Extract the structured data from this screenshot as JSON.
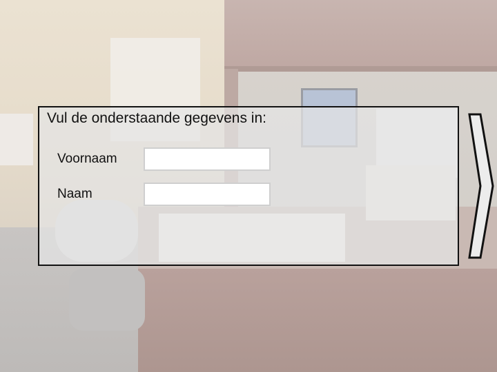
{
  "form": {
    "title": "Vul de onderstaande gegevens in:",
    "fields": [
      {
        "label": "Voornaam",
        "value": "",
        "placeholder": ""
      },
      {
        "label": "Naam",
        "value": "",
        "placeholder": ""
      }
    ]
  },
  "navigation": {
    "next_icon": "chevron-right-icon"
  },
  "colors": {
    "panel_border": "#111111",
    "panel_fill": "#e5e5e5",
    "input_border": "#cfcfcf",
    "arrow_fill": "#ececec"
  }
}
